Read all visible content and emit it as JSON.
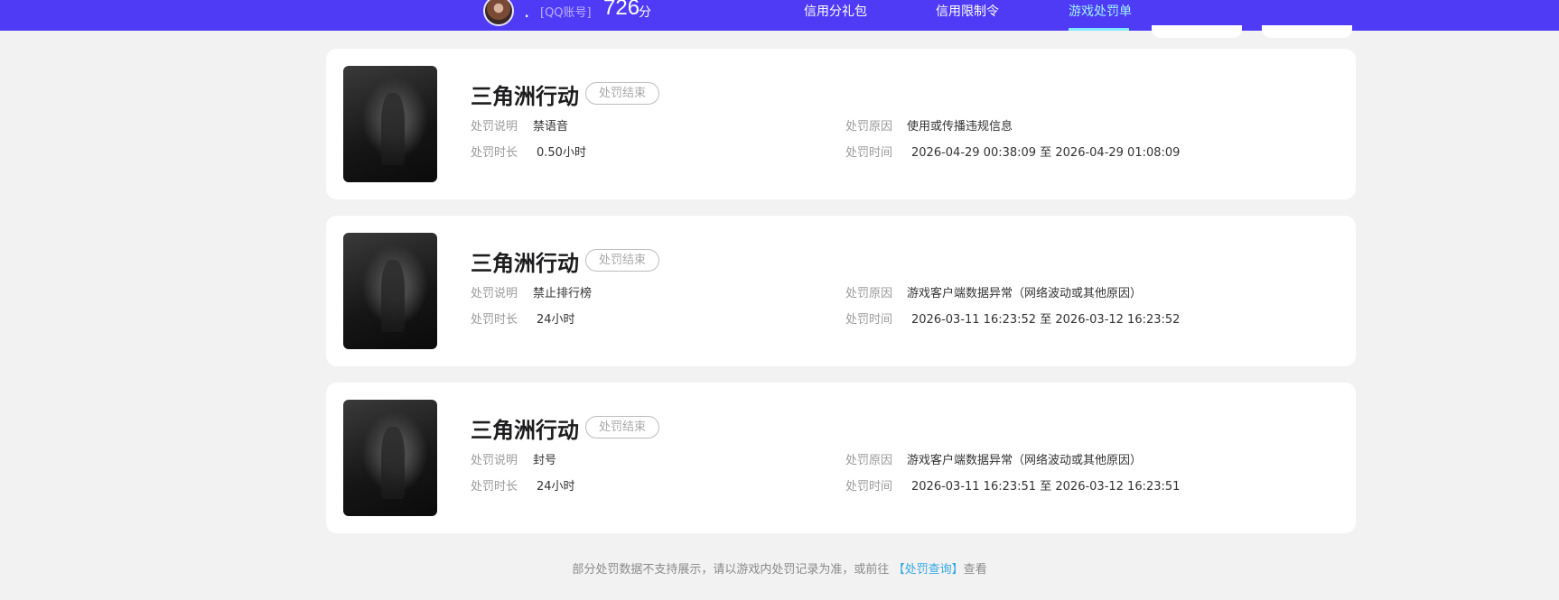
{
  "header": {
    "nickname": ".",
    "qq_label": "[QQ账号]",
    "score": "726",
    "score_unit": "分",
    "nav": [
      "信用分礼包",
      "信用限制令",
      "游戏处罚单"
    ],
    "active_nav": "游戏处罚单",
    "accent_color": "#4f3bf6"
  },
  "labels": {
    "desc": "处罚说明",
    "duration": "处罚时长",
    "reason": "处罚原因",
    "time": "处罚时间",
    "to": "至"
  },
  "records": [
    {
      "game": "三角洲行动",
      "status": "处罚结束",
      "desc": "禁语音",
      "duration": "0.50小时",
      "reason": "使用或传播违规信息",
      "start": "2026-04-29 00:38:09",
      "end": "2026-04-29 01:08:09"
    },
    {
      "game": "三角洲行动",
      "status": "处罚结束",
      "desc": "禁止排行榜",
      "duration": "24小时",
      "reason": "游戏客户端数据异常（网络波动或其他原因）",
      "start": "2026-03-11 16:23:52",
      "end": "2026-03-12 16:23:52"
    },
    {
      "game": "三角洲行动",
      "status": "处罚结束",
      "desc": "封号",
      "duration": "24小时",
      "reason": "游戏客户端数据异常（网络波动或其他原因）",
      "start": "2026-03-11 16:23:51",
      "end": "2026-03-12 16:23:51"
    }
  ],
  "footer": {
    "text_before": "部分处罚数据不支持展示，请以游戏内处罚记录为准，或前往",
    "link": "【处罚查询】",
    "text_after": "查看"
  }
}
